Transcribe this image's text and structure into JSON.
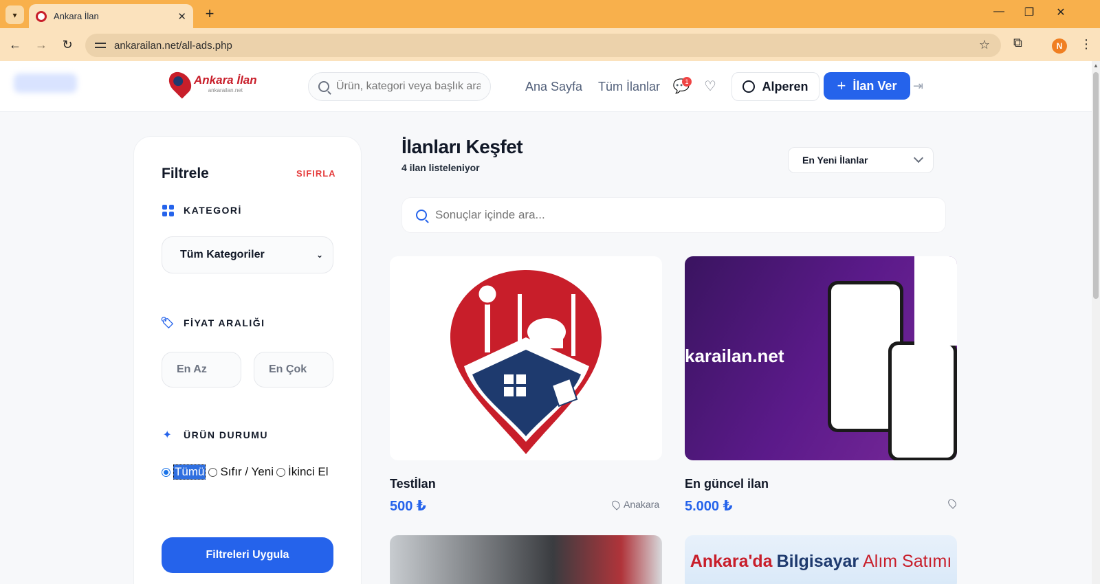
{
  "browser": {
    "tab_title": "Ankara İlan",
    "url": "ankarailan.net/all-ads.php",
    "profile_initial": "N"
  },
  "header": {
    "brand": "Ankara İlan",
    "brand_sub": "ankarailan.net",
    "search_placeholder": "Ürün, kategori veya başlık ara",
    "nav": [
      "Ana Sayfa",
      "Tüm İlanlar"
    ],
    "message_badge": "1",
    "user_name": "Alperen",
    "post_button": "İlan Ver"
  },
  "filters": {
    "title": "Filtrele",
    "reset": "SIFIRLA",
    "category_label": "KATEGORİ",
    "category_value": "Tüm Kategoriler",
    "price_label": "FİYAT ARALIĞI",
    "price_min_placeholder": "En Az",
    "price_max_placeholder": "En Çok",
    "condition_label": "ÜRÜN DURUMU",
    "conditions": [
      "Tümü",
      "Sıfır / Yeni",
      "İkinci El"
    ],
    "apply": "Filtreleri Uygula"
  },
  "main": {
    "title": "İlanları Keşfet",
    "subtitle": "4 ilan listeleniyor",
    "sort_value": "En Yeni İlanlar",
    "search_placeholder": "Sonuçlar içinde ara..."
  },
  "listings": [
    {
      "title": "Testİlan",
      "price": "500 ₺",
      "location": "Anakara"
    },
    {
      "title": "En güncel ilan",
      "price": "5.000 ₺",
      "location": "",
      "image_text": "karailan.net"
    }
  ],
  "banner_fourth": {
    "word1": "Ankara'da",
    "word2": "Bilgisayar",
    "word3": "Alım Satımı"
  },
  "colors": {
    "accent": "#2563eb",
    "danger": "#e53e3e",
    "brand_red": "#c81e2a",
    "brand_navy": "#1e3a6e",
    "chrome_tab": "#f8b04c"
  }
}
